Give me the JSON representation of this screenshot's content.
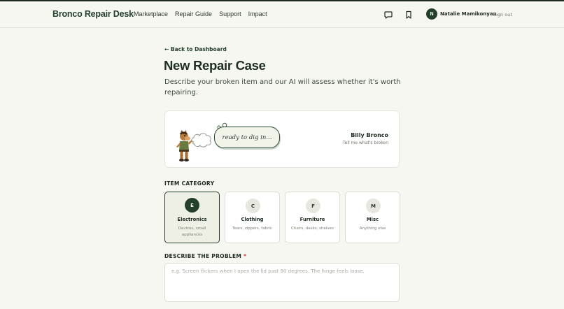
{
  "nav": {
    "brand": "Bronco Repair Desk",
    "links": [
      "Marketplace",
      "Repair Guide",
      "Support",
      "Impact"
    ],
    "icons": [
      "chat-icon",
      "bookmark-icon"
    ],
    "user_initial": "N",
    "user_name": "Natalie Mamikonyan",
    "signout": "Sign out"
  },
  "page": {
    "back_link": "← Back to Dashboard",
    "title": "New Repair Case",
    "subtitle": "Describe your broken item and our AI will assess whether it's worth repairing."
  },
  "mascot": {
    "bubble_text": "ready to dig in...",
    "name": "Billy Bronco",
    "tagline": "Tell me what's broken"
  },
  "category": {
    "label": "ITEM CATEGORY",
    "selected": "Electronics",
    "items": [
      {
        "letter": "E",
        "name": "Electronics",
        "desc": "Devices, small appliances"
      },
      {
        "letter": "C",
        "name": "Clothing",
        "desc": "Tears, zippers, fabric"
      },
      {
        "letter": "F",
        "name": "Furniture",
        "desc": "Chairs, desks, shelves"
      },
      {
        "letter": "M",
        "name": "Misc",
        "desc": "Anything else"
      }
    ]
  },
  "problem": {
    "label": "DESCRIBE THE PROBLEM",
    "required_mark": "*",
    "value": "",
    "placeholder": "e.g. Screen flickers when I open the lid past 90 degrees. The hinge feels loose."
  },
  "colors": {
    "brand_green": "#24402b",
    "background": "#f7f7f2",
    "required_red": "#c0392b"
  }
}
